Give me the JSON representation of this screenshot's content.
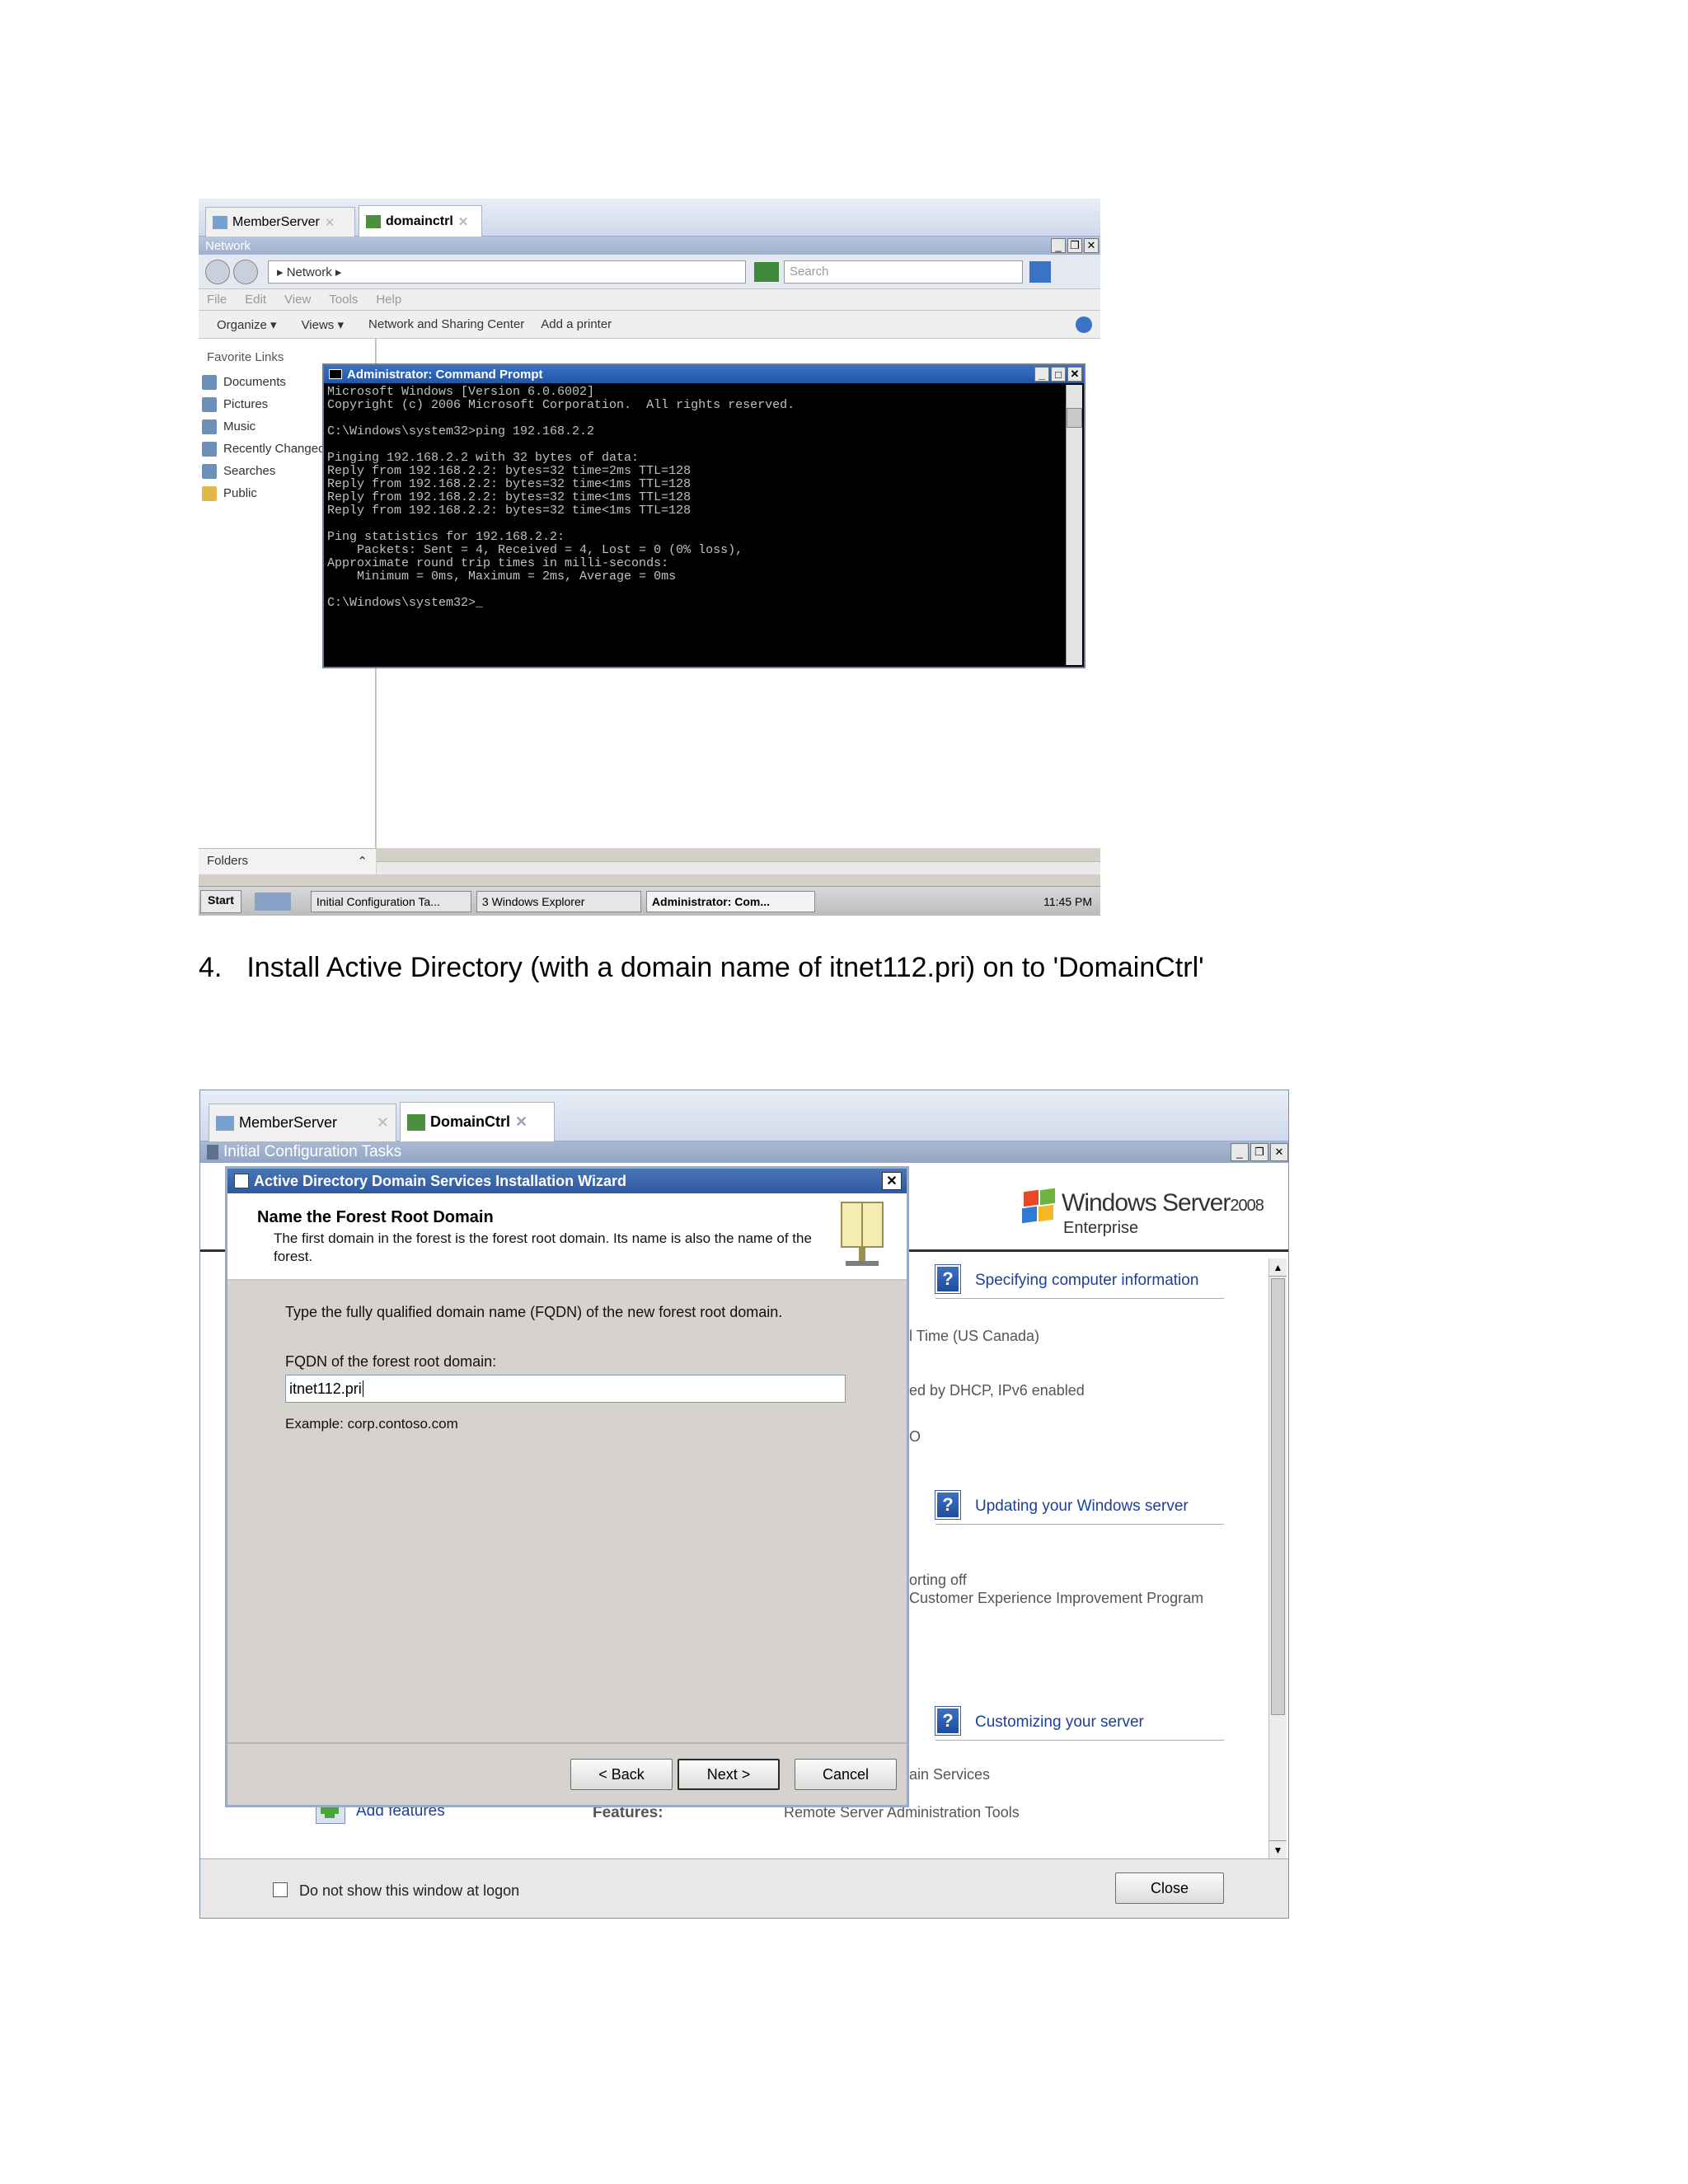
{
  "shot1": {
    "tabs": [
      "MemberServer",
      "domainctrl"
    ],
    "window_title": "Network",
    "address": "▸ Network ▸",
    "search_placeholder": "Search",
    "menu": [
      "File",
      "Edit",
      "View",
      "Tools",
      "Help"
    ],
    "toolbar": [
      "Organize ▾",
      "Views ▾",
      "Network and Sharing Center",
      "Add a printer"
    ],
    "favorites_header": "Favorite Links",
    "favorites": [
      "Documents",
      "Pictures",
      "Music",
      "Recently Changed",
      "Searches",
      "Public"
    ],
    "folders_label": "Folders",
    "cmd_title": "Administrator: Command Prompt",
    "cmd_lines": [
      "Microsoft Windows [Version 6.0.6002]",
      "Copyright (c) 2006 Microsoft Corporation.  All rights reserved.",
      "",
      "C:\\Windows\\system32>ping 192.168.2.2",
      "",
      "Pinging 192.168.2.2 with 32 bytes of data:",
      "Reply from 192.168.2.2: bytes=32 time=2ms TTL=128",
      "Reply from 192.168.2.2: bytes=32 time<1ms TTL=128",
      "Reply from 192.168.2.2: bytes=32 time<1ms TTL=128",
      "Reply from 192.168.2.2: bytes=32 time<1ms TTL=128",
      "",
      "Ping statistics for 192.168.2.2:",
      "    Packets: Sent = 4, Received = 4, Lost = 0 (0% loss),",
      "Approximate round trip times in milli-seconds:",
      "    Minimum = 0ms, Maximum = 2ms, Average = 0ms",
      "",
      "C:\\Windows\\system32>_"
    ],
    "taskbar": {
      "start": "Start",
      "tasks": [
        "Initial Configuration Ta...",
        "3 Windows Explorer",
        "Administrator: Com..."
      ],
      "clock": "11:45 PM"
    }
  },
  "step": {
    "number": "4.",
    "text": "Install Active Directory (with a domain name of itnet112.pri) on to 'DomainCtrl'"
  },
  "shot2": {
    "tabs": [
      "MemberServer",
      "DomainCtrl"
    ],
    "ict_title": "Initial Configuration Tasks",
    "brand": {
      "name": "Windows Server",
      "version": "2008",
      "edition": "Enterprise"
    },
    "wizard": {
      "title": "Active Directory Domain Services Installation Wizard",
      "heading": "Name the Forest Root Domain",
      "description": "The first domain in the forest is the forest root domain. Its name is also the name of the forest.",
      "instruction": "Type the fully qualified domain name (FQDN) of the new forest root domain.",
      "field_label": "FQDN of the forest root domain:",
      "field_value": "itnet112.pri",
      "example": "Example: corp.contoso.com",
      "buttons": {
        "back": "< Back",
        "next": "Next >",
        "cancel": "Cancel"
      }
    },
    "sections": [
      {
        "title": "Specifying computer information",
        "lines": [
          "l Time (US  Canada)",
          "ed by DHCP, IPv6 enabled",
          "O"
        ]
      },
      {
        "title": "Updating your Windows server",
        "lines": [
          "orting off",
          "Customer Experience Improvement Program"
        ]
      },
      {
        "title": "Customizing your server",
        "lines": [
          "ain Services"
        ]
      }
    ],
    "features_row": {
      "add": "Add features",
      "label": "Features:",
      "value": "Remote Server Administration Tools"
    },
    "footer": {
      "checkbox_label": "Do not show this window at logon",
      "close": "Close"
    }
  }
}
